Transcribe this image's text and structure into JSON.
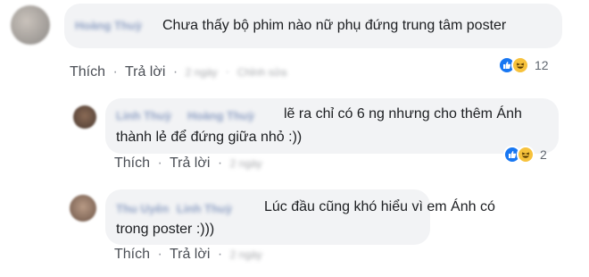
{
  "actions": {
    "like": "Thích",
    "reply": "Trả lời",
    "sep": "·"
  },
  "comments": [
    {
      "author": "Hoàng Thuỳ",
      "text": "Chưa thấy bộ phim nào nữ phụ đứng trung tâm poster",
      "time": "2 ngày",
      "extra": "Chỉnh sửa",
      "reactions": {
        "icons": [
          "like-icon",
          "haha-icon"
        ],
        "count": "12"
      }
    },
    {
      "author": "Linh Thuỳ",
      "mention": "Hoàng Thuỳ",
      "text_line1": "lẽ ra chỉ có 6 ng nhưng cho thêm Ánh",
      "text_line2": "thành lẻ để đứng giữa nhỏ :))",
      "time": "2 ngày",
      "reactions": {
        "icons": [
          "like-icon",
          "haha-icon"
        ],
        "count": "2"
      }
    },
    {
      "author": "Thu Uyên",
      "mention": "Linh Thuỳ",
      "text_line1": "Lúc đầu cũng khó hiểu vì em Ánh có",
      "text_line2": "trong poster :)))",
      "time": "2 ngày"
    }
  ],
  "colors": {
    "bubble": "#f2f3f5",
    "link": "#4b4f56",
    "author": "#385898",
    "like": "#1877f2",
    "haha": "#f7c23c"
  }
}
